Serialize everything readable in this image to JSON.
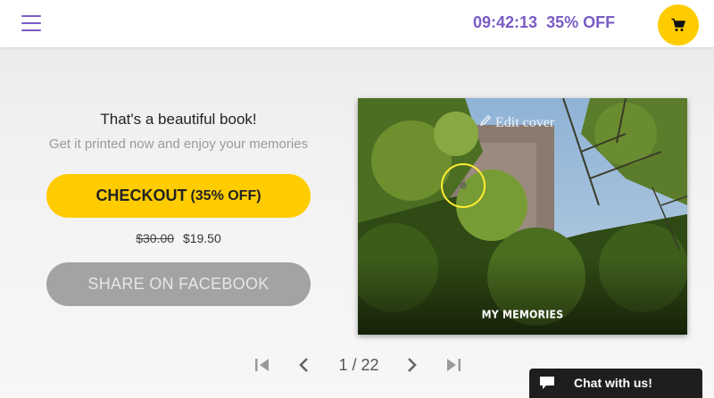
{
  "header": {
    "menu_icon": "hamburger-menu-icon",
    "countdown": "09:42:13",
    "discount": "35% OFF",
    "cart_icon": "shopping-cart-icon"
  },
  "promo_panel": {
    "headline": "That's a beautiful book!",
    "subline": "Get it printed now and enjoy your memories",
    "checkout_label": "CHECKOUT",
    "checkout_discount": "(35% OFF)",
    "old_price": "$30.00",
    "new_price": "$19.50",
    "share_label": "SHARE ON FACEBOOK"
  },
  "book_preview": {
    "edit_label": "Edit cover",
    "title": "MY MEMORIES"
  },
  "pager": {
    "first_icon": "skip-first-icon",
    "prev_icon": "chevron-left-icon",
    "counter": "1 / 22",
    "next_icon": "chevron-right-icon",
    "last_icon": "skip-last-icon"
  },
  "chat": {
    "label": "Chat with us!",
    "icon": "chat-bubble-icon"
  },
  "colors": {
    "accent_purple": "#7a5cc4",
    "brand_yellow": "#ffcc00",
    "share_gray": "#a3a3a3",
    "chat_dark": "#1e1e1e"
  }
}
